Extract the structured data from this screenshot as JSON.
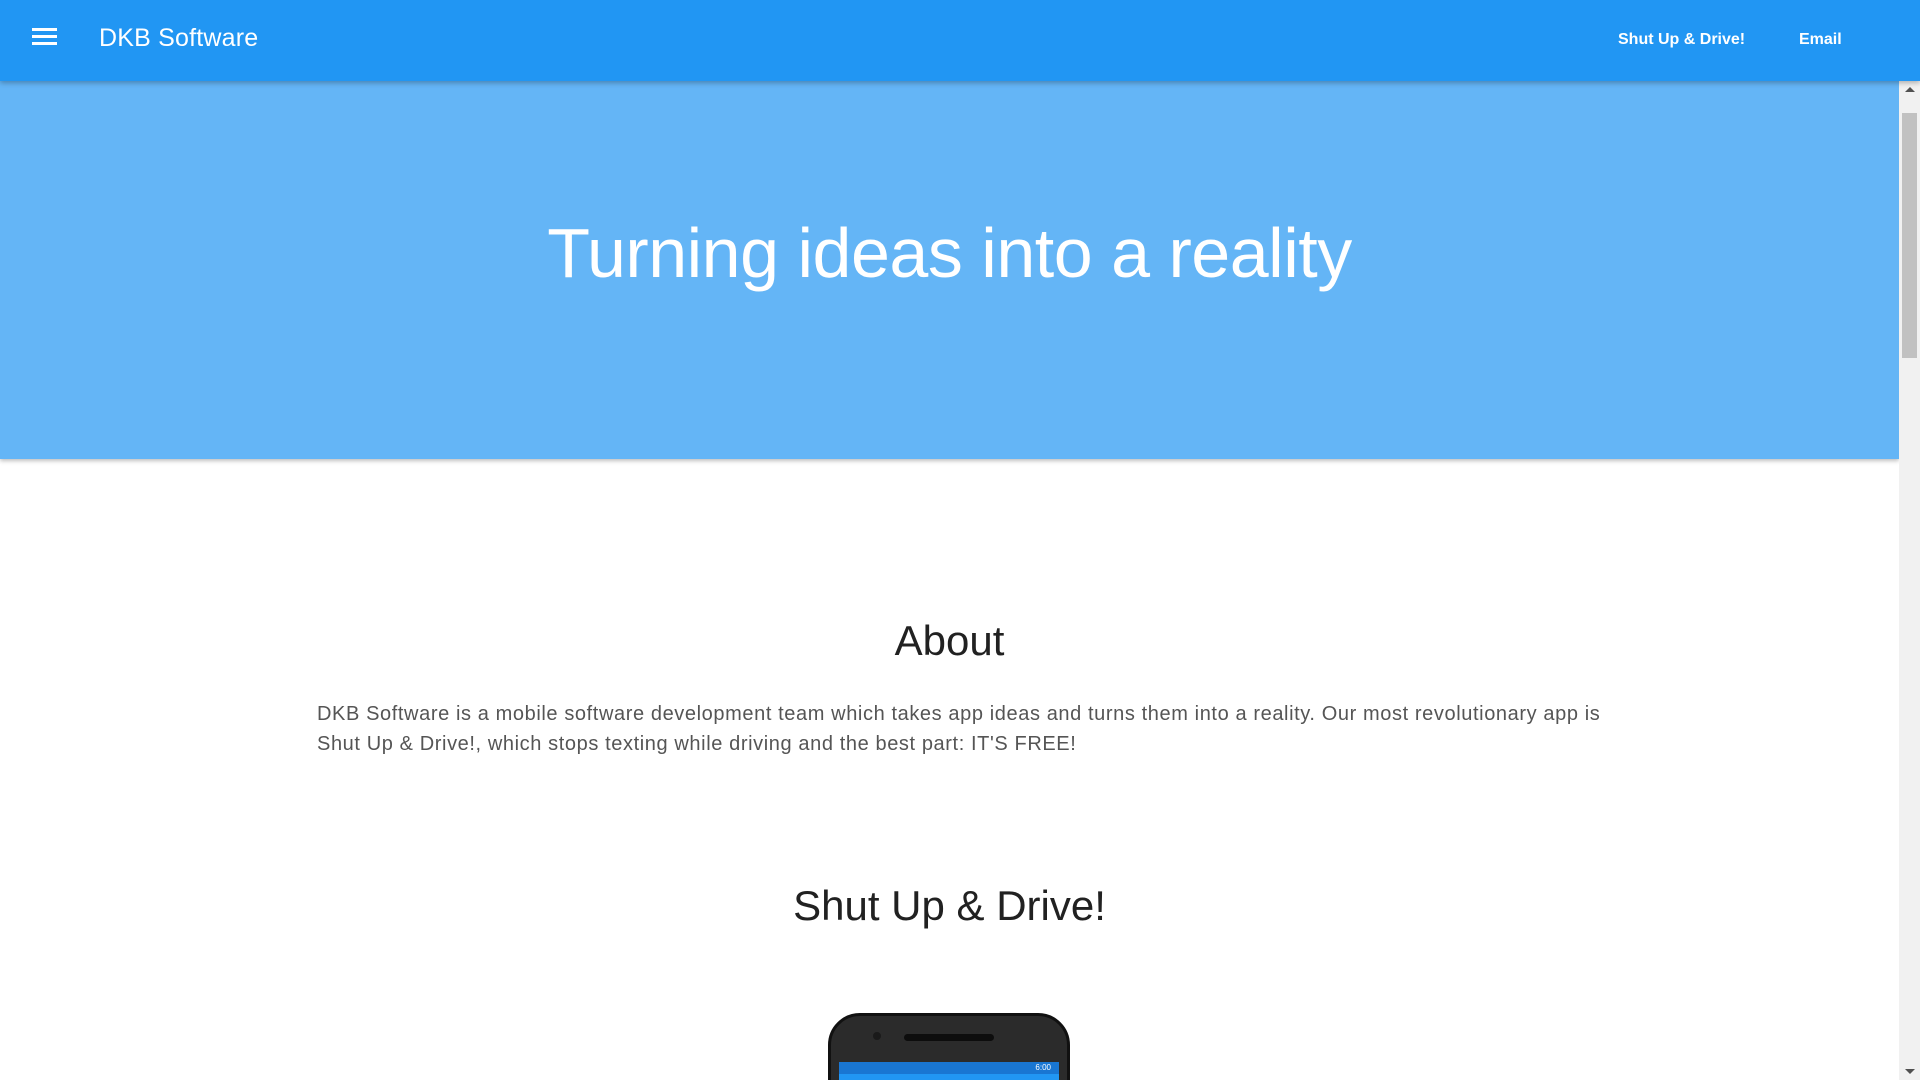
{
  "header": {
    "brand": "DKB Software",
    "menu_icon": "hamburger-menu-icon",
    "nav": [
      {
        "label": "Shut Up & Drive!"
      },
      {
        "label": "Email"
      }
    ],
    "color": "#2196f3"
  },
  "hero": {
    "title": "Turning ideas into a reality",
    "color": "#64b5f6"
  },
  "about": {
    "title": "About",
    "text": "DKB Software is a mobile software development team which takes app ideas and turns them into a reality. Our most revolutionary app is Shut Up & Drive!, which stops texting while driving and the best part: IT'S FREE!"
  },
  "product": {
    "title": "Shut Up & Drive!",
    "phone_status_time": "6:00"
  }
}
